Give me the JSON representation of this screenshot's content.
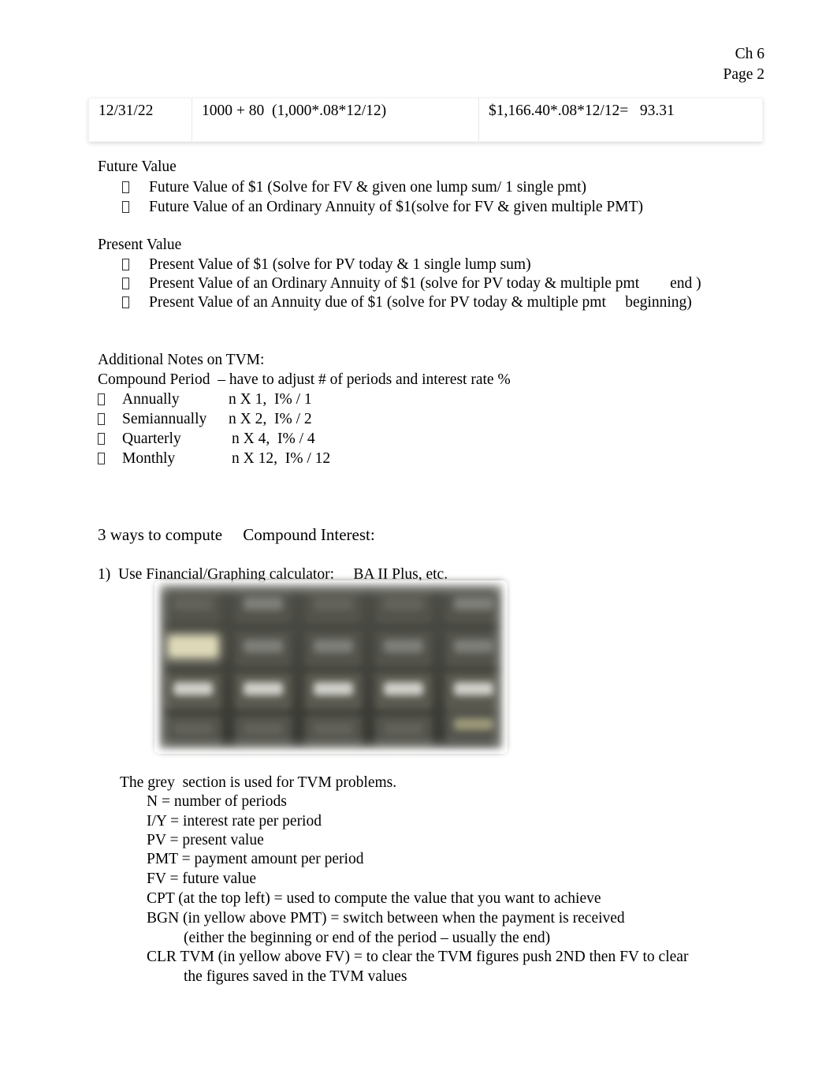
{
  "document": {
    "header": {
      "chapter": "Ch 6",
      "page": "Page 2"
    },
    "table": {
      "rows": [
        {
          "date": "12/31/22",
          "calculation": "1000 + 80  (1,000*.08*12/12)",
          "result": "$1,166.40*.08*12/12=   93.31"
        }
      ]
    },
    "future_value": {
      "heading": "Future Value",
      "items": [
        "Future Value of $1 (Solve for FV & given one lump sum/ 1 single pmt)",
        "Future Value of an Ordinary Annuity of $1(solve for FV & given multiple PMT)"
      ]
    },
    "present_value": {
      "heading": "Present Value",
      "items": [
        "Present Value of $1 (solve for PV today & 1 single lump sum)",
        "Present Value of an Ordinary Annuity of $1 (solve for PV today & multiple pmt        end )",
        "Present Value of an Annuity due of $1 (solve for PV today & multiple pmt     beginning)"
      ]
    },
    "additional_notes": {
      "heading": "Additional Notes on TVM:",
      "subheading": "Compound Period  – have to adjust # of periods and interest rate %",
      "items": [
        {
          "label": "Annually",
          "formula": "n X 1,  I% / 1"
        },
        {
          "label": "Semiannually",
          "formula": "n X 2,  I% / 2"
        },
        {
          "label": "Quarterly",
          "formula": "n X 4,  I% / 4"
        },
        {
          "label": "Monthly",
          "formula": "n X 12,  I% / 12"
        }
      ]
    },
    "compute_section": {
      "heading": "3 ways to compute     Compound Interest:",
      "item1": "1)  Use Financial/Graphing calculator:     BA II Plus, etc.",
      "image_caption": "blurred-photo-of-BA-II-Plus-calculator-keypad"
    },
    "calculator_notes": {
      "intro": "The grey  section is used for TVM problems.",
      "definitions": [
        "N = number of periods",
        "I/Y = interest rate per period",
        "PV = present value",
        "PMT = payment amount per period",
        "FV = future value",
        "CPT (at the top left) = used to compute the value that you want to achieve",
        "BGN (in yellow above PMT) = switch between when the payment is received"
      ],
      "bgn_continuation": "(either the beginning or end of the period – usually the end)",
      "clr_tvm": "CLR TVM (in yellow above FV) = to clear the TVM figures push 2ND then FV to clear",
      "clr_tvm_continuation": "the figures saved in the TVM values"
    },
    "colors": {
      "text": "#000000",
      "page_background": "#ffffff",
      "calculator_body": "#46463f",
      "calculator_key": "#53534c",
      "calculator_key_cap": "#8e8e88",
      "calculator_highlight_yellow": "#ddd9b8",
      "table_border": "#f3f3f3"
    }
  }
}
